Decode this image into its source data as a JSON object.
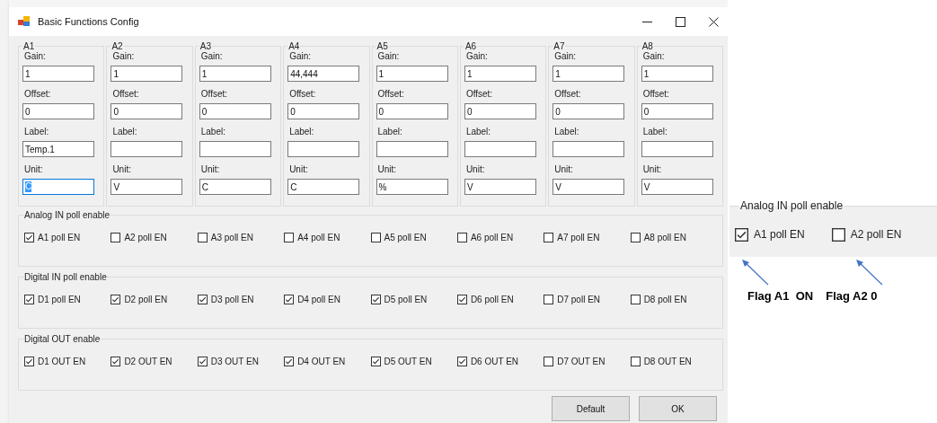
{
  "window": {
    "title": "Basic Functions Config"
  },
  "channels": [
    {
      "name": "A1",
      "fields": [
        {
          "label": "Gain:",
          "value": "1",
          "focused": false
        },
        {
          "label": "Offset:",
          "value": "0",
          "focused": false
        },
        {
          "label": "Label:",
          "value": "Temp.1",
          "focused": false
        },
        {
          "label": "Unit:",
          "value": "C",
          "focused": true
        }
      ]
    },
    {
      "name": "A2",
      "fields": [
        {
          "label": "Gain:",
          "value": "1",
          "focused": false
        },
        {
          "label": "Offset:",
          "value": "0",
          "focused": false
        },
        {
          "label": "Label:",
          "focused": false
        },
        {
          "label": "Unit:",
          "value": "V",
          "focused": false
        }
      ]
    },
    {
      "name": "A3",
      "fields": [
        {
          "label": "Gain:",
          "value": "1",
          "focused": false
        },
        {
          "label": "Offset:",
          "value": "0",
          "focused": false
        },
        {
          "label": "Label:",
          "focused": false
        },
        {
          "label": "Unit:",
          "value": "C",
          "focused": false
        }
      ]
    },
    {
      "name": "A4",
      "fields": [
        {
          "label": "Gain:",
          "value": "44,444",
          "focused": false
        },
        {
          "label": "Offset:",
          "value": "0",
          "focused": false
        },
        {
          "label": "Label:",
          "focused": false
        },
        {
          "label": "Unit:",
          "value": "C",
          "focused": false
        }
      ]
    },
    {
      "name": "A5",
      "fields": [
        {
          "label": "Gain:",
          "value": "1",
          "focused": false
        },
        {
          "label": "Offset:",
          "value": "0",
          "focused": false
        },
        {
          "label": "Label:",
          "focused": false
        },
        {
          "label": "Unit:",
          "value": "%",
          "focused": false
        }
      ]
    },
    {
      "name": "A6",
      "fields": [
        {
          "label": "Gain:",
          "value": "1",
          "focused": false
        },
        {
          "label": "Offset:",
          "value": "0",
          "focused": false
        },
        {
          "label": "Label:",
          "focused": false
        },
        {
          "label": "Unit:",
          "value": "V",
          "focused": false
        }
      ]
    },
    {
      "name": "A7",
      "fields": [
        {
          "label": "Gain:",
          "value": "1",
          "focused": false
        },
        {
          "label": "Offset:",
          "value": "0",
          "focused": false
        },
        {
          "label": "Label:",
          "focused": false
        },
        {
          "label": "Unit:",
          "value": "V",
          "focused": false
        }
      ]
    },
    {
      "name": "A8",
      "fields": [
        {
          "label": "Gain:",
          "value": "1",
          "focused": false
        },
        {
          "label": "Offset:",
          "value": "0",
          "focused": false
        },
        {
          "label": "Label:",
          "focused": false
        },
        {
          "label": "Unit:",
          "value": "V",
          "focused": false
        }
      ]
    }
  ],
  "groups": [
    {
      "title": "Analog IN poll enable",
      "items": [
        {
          "label": "A1 poll EN",
          "checked": true
        },
        {
          "label": "A2 poll EN",
          "checked": false
        },
        {
          "label": "A3 poll EN",
          "checked": false
        },
        {
          "label": "A4 poll EN",
          "checked": false
        },
        {
          "label": "A5 poll EN",
          "checked": false
        },
        {
          "label": "A6 poll EN",
          "checked": false
        },
        {
          "label": "A7 poll EN",
          "checked": false
        },
        {
          "label": "A8 poll EN",
          "checked": false
        }
      ]
    },
    {
      "title": "Digital IN poll enable",
      "items": [
        {
          "label": "D1 poll EN",
          "checked": true
        },
        {
          "label": "D2 poll EN",
          "checked": true
        },
        {
          "label": "D3 poll EN",
          "checked": true
        },
        {
          "label": "D4 poll EN",
          "checked": true
        },
        {
          "label": "D5 poll EN",
          "checked": true
        },
        {
          "label": "D6 poll EN",
          "checked": true
        },
        {
          "label": "D7 poll EN",
          "checked": false
        },
        {
          "label": "D8 poll EN",
          "checked": false
        }
      ]
    },
    {
      "title": "Digital OUT enable",
      "items": [
        {
          "label": "D1 OUT EN",
          "checked": true
        },
        {
          "label": "D2 OUT EN",
          "checked": true
        },
        {
          "label": "D3 OUT EN",
          "checked": true
        },
        {
          "label": "D4 OUT EN",
          "checked": true
        },
        {
          "label": "D5 OUT EN",
          "checked": true
        },
        {
          "label": "D6 OUT EN",
          "checked": true
        },
        {
          "label": "D7 OUT EN",
          "checked": false
        },
        {
          "label": "D8 OUT EN",
          "checked": false
        }
      ]
    }
  ],
  "buttons": [
    "Default",
    "OK"
  ],
  "callout": {
    "title": "Analog IN poll enable",
    "items": [
      {
        "label": "A1 poll EN",
        "checked": true
      },
      {
        "label": "A2 poll EN",
        "checked": false
      }
    ],
    "annotations": [
      "Flag A1  ON",
      "Flag A2 0"
    ]
  }
}
